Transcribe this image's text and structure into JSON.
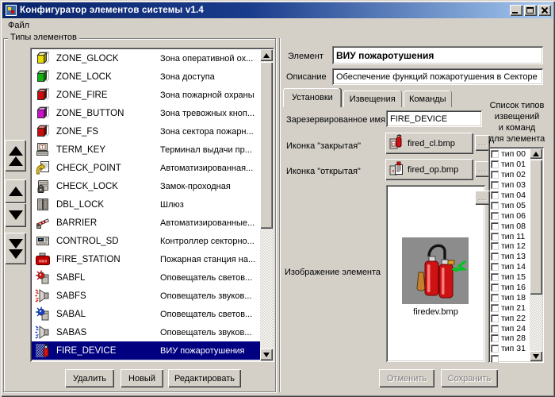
{
  "window": {
    "title": "Конфигуратор элементов системы v1.4"
  },
  "menu": {
    "items": [
      {
        "label": "Файл",
        "name": "menu-file"
      }
    ]
  },
  "left_panel": {
    "group_title": "Типы элементов",
    "rows": [
      {
        "icon": "cube-yellow-icon",
        "name": "ZONE_GLOCK",
        "desc": "Зона оперативной ох...",
        "selected": false
      },
      {
        "icon": "cube-green-icon",
        "name": "ZONE_LOCK",
        "desc": "Зона доступа",
        "selected": false
      },
      {
        "icon": "cube-red-icon",
        "name": "ZONE_FIRE",
        "desc": "Зона пожарной охраны",
        "selected": false
      },
      {
        "icon": "cube-magenta-icon",
        "name": "ZONE_BUTTON",
        "desc": "Зона тревожных кноп...",
        "selected": false
      },
      {
        "icon": "cube-red-icon",
        "name": "ZONE_FS",
        "desc": "Зона сектора пожарн...",
        "selected": false
      },
      {
        "icon": "terminal-icon",
        "name": "TERM_KEY",
        "desc": "Терминал выдачи пр...",
        "selected": false
      },
      {
        "icon": "checkpoint-icon",
        "name": "CHECK_POINT",
        "desc": "Автоматизированная...",
        "selected": false
      },
      {
        "icon": "lock-icon",
        "name": "CHECK_LOCK",
        "desc": "Замок-проходная",
        "selected": false
      },
      {
        "icon": "double-door-icon",
        "name": "DBL_LOCK",
        "desc": "Шлюз",
        "selected": false
      },
      {
        "icon": "barrier-icon",
        "name": "BARRIER",
        "desc": "Автоматизированные...",
        "selected": false
      },
      {
        "icon": "controller-icon",
        "name": "CONTROL_SD",
        "desc": "Контроллер секторно...",
        "selected": false
      },
      {
        "icon": "fire-station-icon",
        "name": "FIRE_STATION",
        "desc": "Пожарная станция на...",
        "selected": false
      },
      {
        "icon": "lamp-red-icon",
        "name": "SABFL",
        "desc": "Оповещатель светов...",
        "selected": false
      },
      {
        "icon": "speaker-red-icon",
        "name": "SABFS",
        "desc": "Оповещатель звуков...",
        "selected": false
      },
      {
        "icon": "lamp-blue-icon",
        "name": "SABAL",
        "desc": "Оповещатель светов...",
        "selected": false
      },
      {
        "icon": "speaker-blue-icon",
        "name": "SABAS",
        "desc": "Оповещатель звуков...",
        "selected": false
      },
      {
        "icon": "fire-device-icon",
        "name": "FIRE_DEVICE",
        "desc": "ВИУ пожаротушения",
        "selected": true
      }
    ],
    "buttons": [
      {
        "label": "Удалить",
        "name": "delete-button"
      },
      {
        "label": "Новый",
        "name": "new-button"
      },
      {
        "label": "Редактировать",
        "name": "edit-button"
      }
    ]
  },
  "right_panel": {
    "element_label": "Элемент",
    "element_value": "ВИУ пожаротушения",
    "description_label": "Описание",
    "description_value": "Обеспечение функций пожаротушения в Секторе",
    "tabs": [
      {
        "label": "Установки",
        "name": "tab-settings",
        "active": true
      },
      {
        "label": "Извещения",
        "name": "tab-notifications",
        "active": false
      },
      {
        "label": "Команды",
        "name": "tab-commands",
        "active": false
      }
    ],
    "reserved_name_label": "Зарезервированное имя",
    "reserved_name_value": "FIRE_DEVICE",
    "icon_closed_label": "Иконка \"закрытая\"",
    "icon_closed_value": "fired_cl.bmp",
    "icon_open_label": "Иконка \"открытая\"",
    "icon_open_value": "fired_op.bmp",
    "browse_label": "...",
    "image_label": "Изображение элемента",
    "image_caption": "firedev.bmp",
    "types_list_title": "Список типов\nизвещений\nи команд\nдля элемента",
    "type_items": [
      "тип 00",
      "тип 01",
      "тип 02",
      "тип 03",
      "тип 04",
      "тип 05",
      "тип 06",
      "тип 08",
      "тип 11",
      "тип 12",
      "тип 13",
      "тип 14",
      "тип 15",
      "тип 16",
      "тип 18",
      "тип 21",
      "тип 22",
      "тип 24",
      "тип 28",
      "тип 31"
    ],
    "cancel_label": "Отменить",
    "save_label": "Сохранить"
  },
  "colors": {
    "window_bg": "#d4d0c8",
    "titlebar_start": "#0a246a",
    "titlebar_end": "#a6caf0",
    "selection": "#000080",
    "selection_text": "#ffffff"
  }
}
